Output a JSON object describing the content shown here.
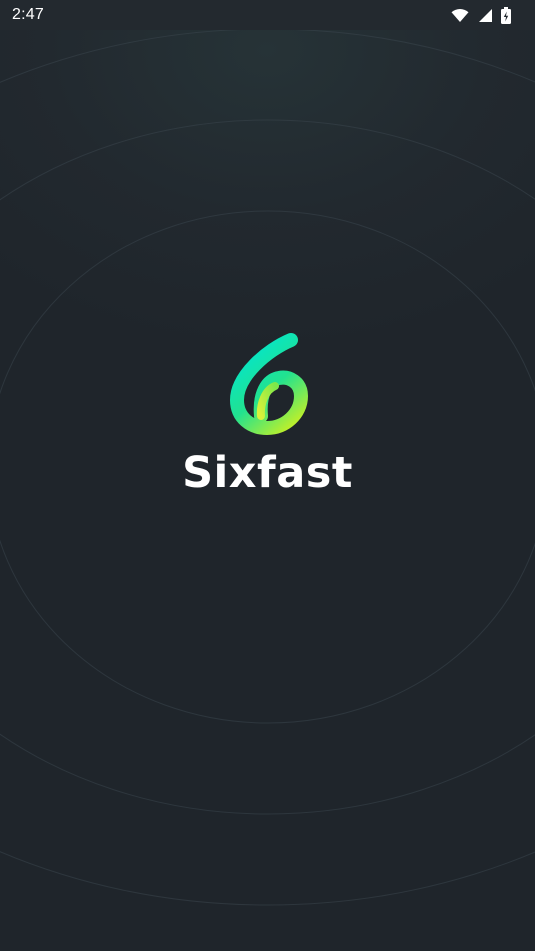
{
  "status_bar": {
    "time": "2:47",
    "icons": [
      "wifi-icon",
      "cellular-signal-icon",
      "battery-charging-icon"
    ]
  },
  "splash": {
    "brand_name": "Sixfast",
    "logo_icon": "sixfast-logo-icon",
    "colors": {
      "background": "#1f252b",
      "accent_start": "#00e5d2",
      "accent_end": "#b8ef2e",
      "text": "#ffffff"
    }
  }
}
